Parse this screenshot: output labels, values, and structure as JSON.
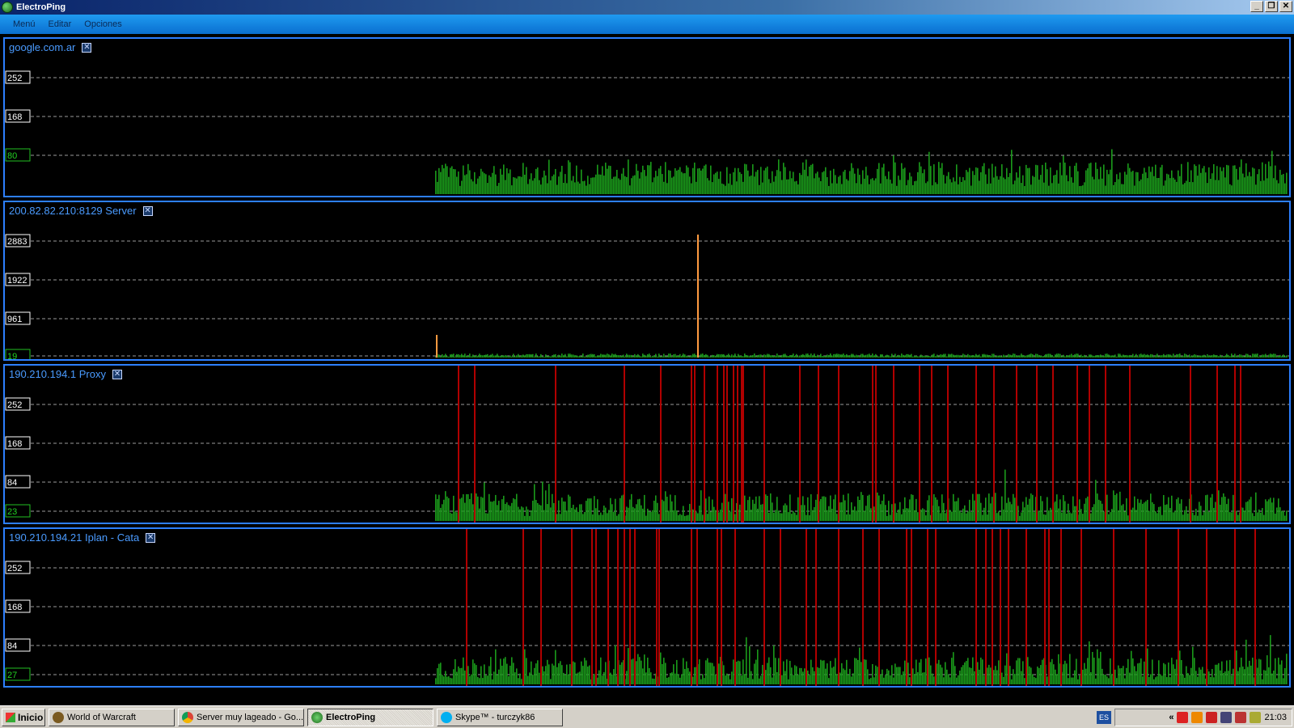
{
  "window": {
    "title": "ElectroPing",
    "buttons": [
      "_",
      "❐",
      "✕"
    ]
  },
  "menu": [
    "Menú",
    "Editar",
    "Opciones"
  ],
  "panels": [
    {
      "title": "google.com.ar",
      "ticks": [
        "252",
        "168",
        "80"
      ],
      "current": "80",
      "spikes": [],
      "color_ok": "#1a9a1a",
      "color_timeout": "#c00000"
    },
    {
      "title": "200.82.82.210:8129  Server",
      "ticks": [
        "2883",
        "1922",
        "961",
        "19"
      ],
      "current": "19",
      "spikes": [],
      "color_ok": "#1a9a1a",
      "color_high": "#ff9a40"
    },
    {
      "title": "190.210.194.1  Proxy",
      "ticks": [
        "252",
        "168",
        "84",
        "23"
      ],
      "current": "23",
      "color_ok": "#1a9a1a",
      "color_timeout": "#b00000"
    },
    {
      "title": "190.210.194.21  Iplan - Cata",
      "ticks": [
        "252",
        "168",
        "84",
        "27"
      ],
      "current": "27",
      "color_ok": "#1a9a1a",
      "color_timeout": "#b00000"
    }
  ],
  "taskbar": {
    "start_label": "Inicio",
    "tasks": [
      {
        "label": "World of Warcraft",
        "icon": "wow-icon",
        "active": false
      },
      {
        "label": "Server muy lageado - Go...",
        "icon": "chrome-icon",
        "active": false
      },
      {
        "label": "ElectroPing",
        "icon": "electroping-icon",
        "active": true
      },
      {
        "label": "Skype™ - turczyk86",
        "icon": "skype-icon",
        "active": false
      }
    ],
    "language": "ES",
    "clock": "21:03"
  },
  "chart_data": [
    {
      "type": "bar",
      "title": "google.com.ar",
      "yticks": [
        252,
        168,
        80
      ],
      "ylim": [
        0,
        300
      ],
      "series": [
        {
          "values_summary": "ping samples mostly 20-60 ms with peaks near 80"
        }
      ]
    },
    {
      "type": "bar",
      "title": "200.82.82.210:8129  Server",
      "yticks": [
        2883,
        1922,
        961,
        19
      ],
      "ylim": [
        0,
        3400
      ],
      "series": [
        {
          "values_summary": "low pings (~19 ms) with spikes near 600 and 2883"
        }
      ]
    },
    {
      "type": "bar",
      "title": "190.210.194.1  Proxy",
      "yticks": [
        252,
        168,
        84,
        23
      ],
      "ylim": [
        0,
        300
      ],
      "series": [
        {
          "values_summary": "pings ~20-80 ms with many timeout bars"
        }
      ]
    },
    {
      "type": "bar",
      "title": "190.210.194.21  Iplan - Cata",
      "yticks": [
        252,
        168,
        84,
        27
      ],
      "ylim": [
        0,
        300
      ],
      "series": [
        {
          "values_summary": "pings ~27-90 ms with many timeout bars"
        }
      ]
    }
  ]
}
